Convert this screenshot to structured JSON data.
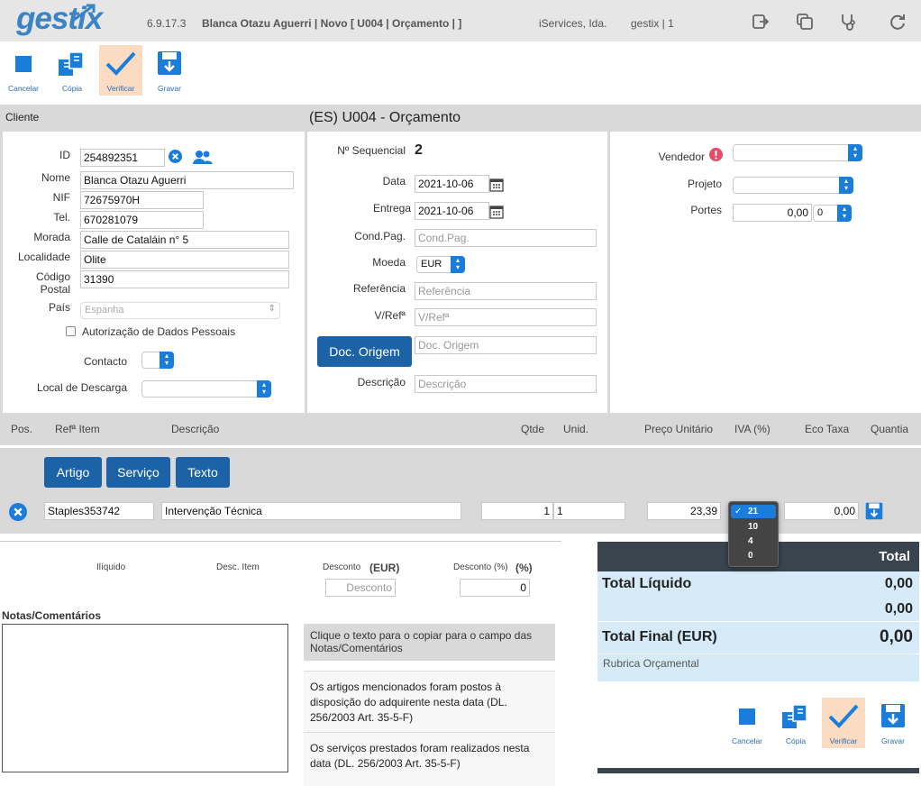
{
  "app": {
    "logo": "gestix",
    "version": "6.9.17.3",
    "context": "Blanca Otazu Aguerri | Novo [ U004 | Orçamento | ]",
    "company": "iServices, Ida.",
    "session": "gestix | 1"
  },
  "header_icons": [
    "logout-icon",
    "windows-icon",
    "stethoscope-icon",
    "refresh-icon"
  ],
  "toolbar_top": {
    "cancel": "Cancelar",
    "copy": "Cópia",
    "verify": "Verificar",
    "save": "Gravar"
  },
  "section": {
    "cliente": "Cliente",
    "title": "(ES) U004 - Orçamento"
  },
  "client": {
    "id_label": "ID",
    "id_value": "254892351",
    "name_label": "Nome",
    "name_value": "Blanca Otazu Aguerri",
    "nif_label": "NIF",
    "nif_value": "72675970H",
    "tel_label": "Tel.",
    "tel_value": "670281079",
    "morada_label": "Morada",
    "morada_value": "Calle de Cataláin n° 5",
    "localidade_label": "Localidade",
    "localidade_value": "Olite",
    "cp_label_1": "Código",
    "cp_label_2": "Postal",
    "cp_value": "31390",
    "pais_label": "País",
    "pais_placeholder": "Espanha",
    "auth_label": "Autorização de Dados Pessoais",
    "contacto_label": "Contacto",
    "descarga_label": "Local de Descarga"
  },
  "document": {
    "seq_label": "Nº Sequencial",
    "seq_value": "2",
    "data_label": "Data",
    "data_value": "2021-10-06",
    "entrega_label": "Entrega",
    "entrega_value": "2021-10-06",
    "condpag_label": "Cond.Pag.",
    "condpag_placeholder": "Cond.Pag.",
    "moeda_label": "Moeda",
    "moeda_value": "EUR",
    "ref_label": "Referência",
    "ref_placeholder": "Referência",
    "vref_label": "V/Refª",
    "vref_placeholder": "V/Refª",
    "origem_button": "Doc. Origem",
    "origem_placeholder": "Doc. Origem",
    "desc_label": "Descrição",
    "desc_placeholder": "Descrição"
  },
  "seller": {
    "vendedor_label": "Vendedor",
    "projeto_label": "Projeto",
    "portes_label": "Portes",
    "portes_value": "0,00",
    "portes_tax": "0"
  },
  "columns": [
    "Pos.",
    "Refª Item",
    "Descrição",
    "Qtde",
    "Unid.",
    "Preço Unitário",
    "IVA (%)",
    "Eco Taxa",
    "Quantia"
  ],
  "item_buttons": [
    "Artigo",
    "Serviço",
    "Texto"
  ],
  "line": {
    "ref": "Staples353742",
    "desc": "Intervenção Técnica",
    "qty": "1",
    "unit": "1",
    "price": "23,39",
    "eco": "0,00"
  },
  "iva_dropdown": {
    "options": [
      "21",
      "10",
      "4",
      "0"
    ],
    "selected": "21"
  },
  "discounts": {
    "iliquido": "Ilíquido",
    "desc_item": "Desc. Item",
    "desconto_label": "Desconto",
    "desconto_unit": "(EUR)",
    "desconto_placeholder": "Desconto",
    "desconto_pct_label": "Desconto (%)",
    "desconto_pct_unit": "(%)",
    "desconto_pct_value": "0"
  },
  "notes": {
    "title": "Notas/Comentários",
    "hint": "Clique o texto para o copiar para o campo das Notas/Comentários",
    "snippet1": "Os artigos mencionados foram postos à disposição do adquirente nesta data (DL. 256/2003 Art. 35-5-F)",
    "snippet2": "Os serviços prestados foram realizados nesta data (DL. 256/2003 Art. 35-5-F)"
  },
  "totals": {
    "header": "Total",
    "liquido_label": "Total Líquido",
    "liquido_value": "0,00",
    "second_value": "0,00",
    "final_label": "Total Final (EUR)",
    "final_value": "0,00",
    "rubrica": "Rubrica Orçamental"
  },
  "toolbar_bottom": {
    "cancel": "Cancelar",
    "copy": "Cópia",
    "verify": "Verificar",
    "save": "Gravar"
  },
  "colors": {
    "accent": "#1a7ddc",
    "button_dark": "#1b63a6",
    "active_tool": "#fbdcc3",
    "alert": "#e84a6a",
    "totals_bg": "#d6ebf7"
  }
}
